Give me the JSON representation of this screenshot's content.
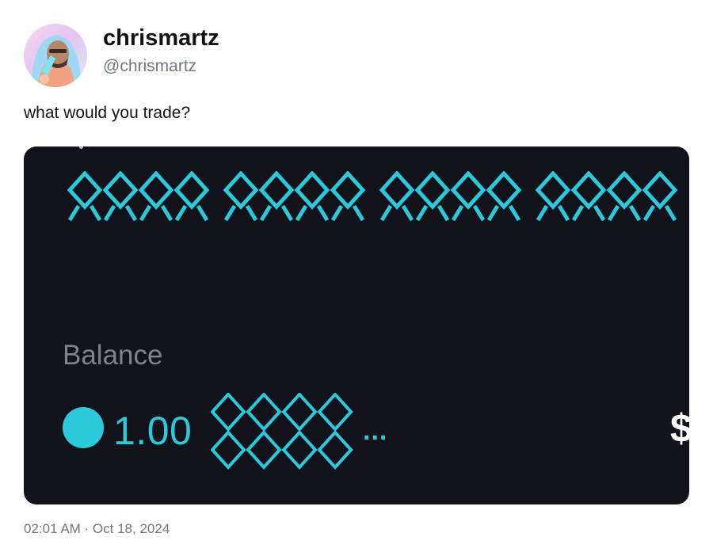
{
  "author": {
    "display_name": "chrismartz",
    "handle": "@chrismartz",
    "avatar_icon": "profile-photo-avatar"
  },
  "tweet": {
    "text": "what would you trade?",
    "timestamp": "02:01 AM · Oct 18, 2024"
  },
  "screenshot": {
    "balance_label": "Balance",
    "balance_amount": "1.00",
    "ellipsis": "...",
    "currency_fragment": "$",
    "token_icon": "teal-circle-token-icon",
    "accent_color": "#2bc9da",
    "background_color": "#12131a"
  }
}
